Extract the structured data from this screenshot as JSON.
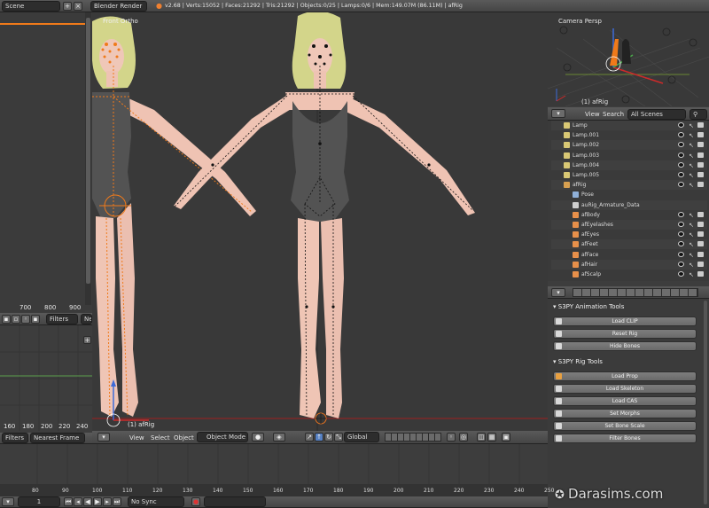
{
  "top_header": {
    "scene_name": "Scene",
    "render_engine": "Blender Render",
    "stats": "v2.68 | Verts:15052 | Faces:21292 | Tris:21292 | Objects:0/25 | Lamps:0/6 | Mem:149.07M (86.11M) | afRig"
  },
  "left_panel": {
    "ruler_labels": [
      "700",
      "800",
      "900"
    ],
    "filters_label": "Filters",
    "ne_label": "Ne",
    "graph_ruler": [
      "160",
      "180",
      "200",
      "220",
      "240"
    ]
  },
  "viewport": {
    "view_name": "Front Ortho",
    "object_label": "(1) afRig",
    "header": {
      "view": "View",
      "select": "Select",
      "object": "Object",
      "mode": "Object Mode",
      "orientation": "Global"
    }
  },
  "camera_view": {
    "title": "Camera Persp",
    "object_label": "(1) afRig"
  },
  "outliner": {
    "header": {
      "view": "View",
      "search": "Search",
      "filter": "All Scenes"
    },
    "rows": [
      {
        "label": "Lamp",
        "type": "lamp",
        "indent": 1
      },
      {
        "label": "Lamp.001",
        "type": "lamp",
        "indent": 1
      },
      {
        "label": "Lamp.002",
        "type": "lamp",
        "indent": 1
      },
      {
        "label": "Lamp.003",
        "type": "lamp",
        "indent": 1
      },
      {
        "label": "Lamp.004",
        "type": "lamp",
        "indent": 1
      },
      {
        "label": "Lamp.005",
        "type": "lamp",
        "indent": 1
      },
      {
        "label": "afRig",
        "type": "armature",
        "indent": 1
      },
      {
        "label": "Pose",
        "type": "pose",
        "indent": 2
      },
      {
        "label": "auRig_Armature_Data",
        "type": "data",
        "indent": 2
      },
      {
        "label": "afBody",
        "type": "mesh",
        "indent": 2
      },
      {
        "label": "afEyelashes",
        "type": "mesh",
        "indent": 2
      },
      {
        "label": "afEyes",
        "type": "mesh",
        "indent": 2
      },
      {
        "label": "afFeet",
        "type": "mesh",
        "indent": 2
      },
      {
        "label": "afFace",
        "type": "mesh",
        "indent": 2
      },
      {
        "label": "afHair",
        "type": "mesh",
        "indent": 2
      },
      {
        "label": "afScalp",
        "type": "mesh",
        "indent": 2
      }
    ]
  },
  "properties": {
    "animation_tools": {
      "title": "S3PY Animation Tools",
      "buttons": [
        "Load CLIP",
        "Reset Rig",
        "Hide Bones"
      ]
    },
    "rig_tools": {
      "title": "S3PY Rig Tools",
      "buttons": [
        "Load Prop",
        "Load Skeleton",
        "Load CAS",
        "Set Morphs",
        "Set Bone Scale",
        "Filter Bones"
      ]
    }
  },
  "bottom_left": {
    "filters": "Filters",
    "nearest_frame": "Nearest Frame"
  },
  "timeline": {
    "ticks": [
      "80",
      "90",
      "100",
      "110",
      "120",
      "130",
      "140",
      "150",
      "160",
      "170",
      "180",
      "190",
      "200",
      "210",
      "220",
      "230",
      "240",
      "250"
    ],
    "current_frame": "1",
    "sync": "No Sync"
  },
  "watermark": "Darasims.com",
  "colors": {
    "selected_orange": "#f07a1a",
    "header_bg": "#4a4a4a",
    "viewport_bg": "#393939"
  }
}
